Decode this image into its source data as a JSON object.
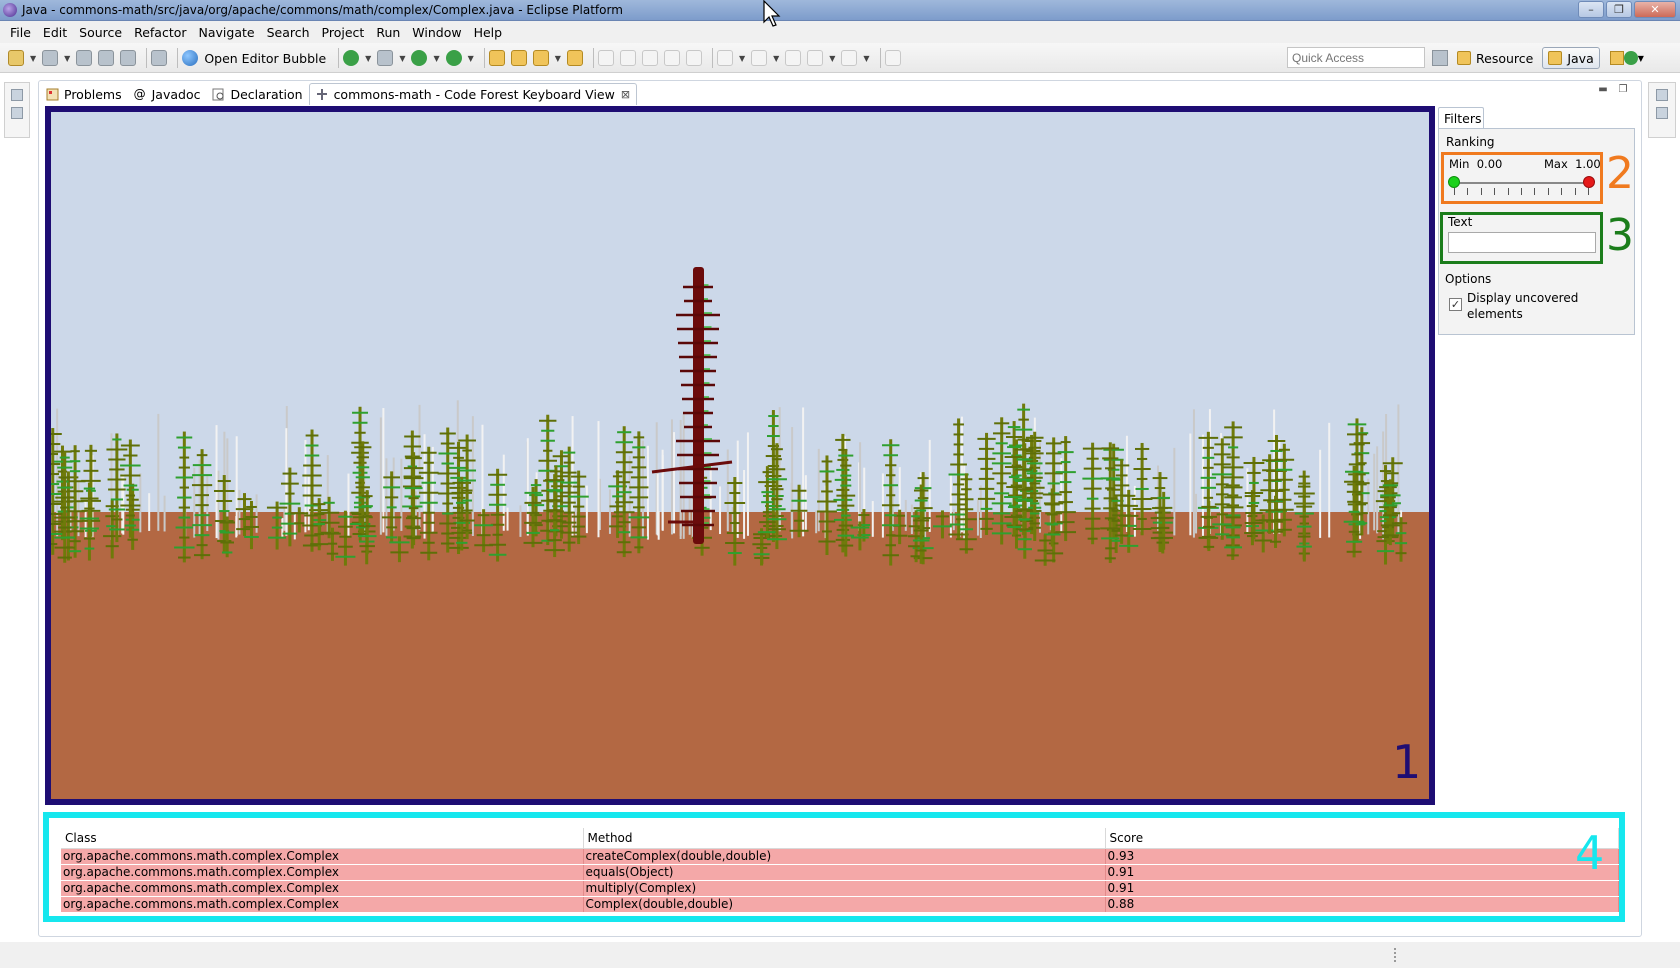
{
  "window": {
    "title": "Java - commons-math/src/java/org/apache/commons/math/complex/Complex.java - Eclipse Platform",
    "buttons": [
      "–",
      "❐",
      "✕"
    ]
  },
  "menubar": {
    "items": [
      "File",
      "Edit",
      "Source",
      "Refactor",
      "Navigate",
      "Search",
      "Project",
      "Run",
      "Window",
      "Help"
    ]
  },
  "toolbar": {
    "open_editor_bubble": "Open Editor Bubble",
    "quick_access_placeholder": "Quick Access",
    "perspectives": [
      "Resource",
      "Java"
    ]
  },
  "tabs": [
    {
      "label": "Problems",
      "icon": "problems-icon"
    },
    {
      "label": "Javadoc",
      "icon": "at-icon"
    },
    {
      "label": "Declaration",
      "icon": "declaration-icon"
    },
    {
      "label": "commons-math - Code Forest Keyboard View",
      "icon": "view-icon",
      "active": true
    }
  ],
  "forest": {
    "annotation": "1",
    "colors": {
      "sky": "#ccd8e9",
      "ground": "#b36843",
      "frame": "#1e0d73",
      "highlight_trunk": "#6b0b0b",
      "tree": "#6f7a0a"
    }
  },
  "filters": {
    "tab_label": "Filters",
    "ranking": {
      "label": "Ranking",
      "min_label": "Min",
      "min_value": "0.00",
      "max_label": "Max",
      "max_value": "1.00",
      "annotation": "2"
    },
    "text": {
      "label": "Text",
      "value": "",
      "annotation": "3"
    },
    "options": {
      "label": "Options",
      "checkbox_label": "Display uncovered elements",
      "checked": true
    }
  },
  "results": {
    "annotation": "4",
    "columns": [
      "Class",
      "Method",
      "Score"
    ],
    "rows": [
      {
        "class": "org.apache.commons.math.complex.Complex",
        "method": "createComplex(double,double)",
        "score": "0.93"
      },
      {
        "class": "org.apache.commons.math.complex.Complex",
        "method": "equals(Object)",
        "score": "0.91"
      },
      {
        "class": "org.apache.commons.math.complex.Complex",
        "method": "multiply(Complex)",
        "score": "0.91"
      },
      {
        "class": "org.apache.commons.math.complex.Complex",
        "method": "Complex(double,double)",
        "score": "0.88"
      }
    ]
  }
}
